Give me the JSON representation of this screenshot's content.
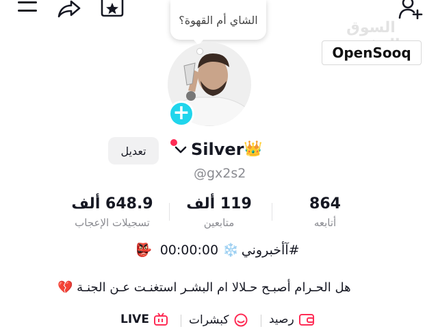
{
  "top_bar": {
    "menu_icon": "hamburger-menu-icon",
    "share_icon": "share-arrow-icon",
    "favorites_icon": "star-box-icon",
    "add_friend_icon": "add-user-icon"
  },
  "watermark": {
    "arabic": "السوق المفتوح",
    "latin": "OpenSooq"
  },
  "note_bubble": {
    "text": "الشاي أم القهوة؟"
  },
  "profile": {
    "edit_label": "تعديل",
    "username": "Silver",
    "crown": "👑",
    "handle": "@gx2s2"
  },
  "stats": [
    {
      "value": "864",
      "label": "أتابعه"
    },
    {
      "value": "119 ألف",
      "label": "متابعين"
    },
    {
      "value": "648.9 ألف",
      "label": "تسجيلات الإعجاب"
    }
  ],
  "bio": {
    "line1_emoji_start": "👺",
    "line1_text": "#آأخبروني",
    "line1_snow": "❄️",
    "line1_time": "00:00:00",
    "line2_text": "هل الحـرام أصبـح حـلالا  ام البشـر استغنـت عـن الجنـة",
    "line2_emoji": "💔"
  },
  "bottom_links": {
    "live": "LIVE",
    "highlights": "كبشرات",
    "balance": "رصيد"
  },
  "colors": {
    "accent": "#fe2c55",
    "add": "#20d5ec",
    "muted": "#8a8b91"
  }
}
